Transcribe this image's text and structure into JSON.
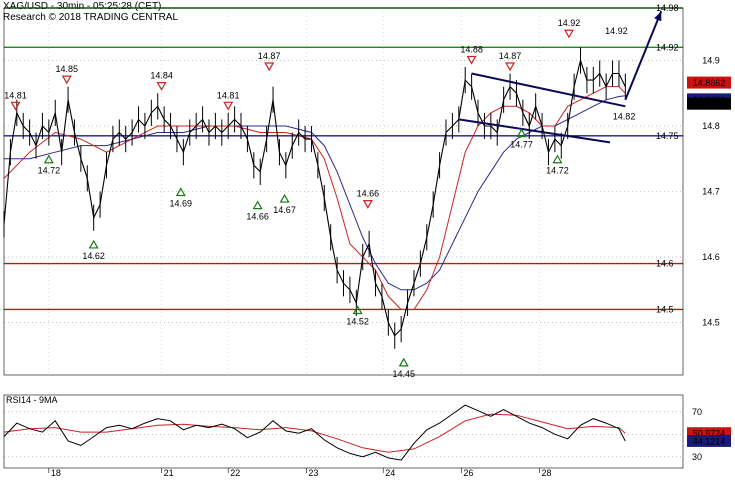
{
  "header": {
    "title": "XAG/USD - 30min - 05:25:28 (CET)",
    "research": "Research © 2018 TRADING CENTRAL"
  },
  "colors": {
    "price": "#000000",
    "ma_fast": "#cc2222",
    "ma_slow": "#2a2a8c",
    "resistance": "#1a8a1a",
    "support": "#cc1111",
    "pivot": "#1a1a99",
    "trendline": "#0a0a55",
    "marker_high": "#cc2222",
    "marker_low": "#1a7a1a"
  },
  "chart_data": [
    {
      "type": "line",
      "title": "",
      "x_ticks": [
        "18",
        "21",
        "22",
        "23",
        "24",
        "26",
        "28"
      ],
      "y_ticks": [
        14.5,
        14.6,
        14.7,
        14.8,
        14.9
      ],
      "ylim": [
        14.42,
        14.98
      ],
      "price_badges": [
        {
          "label": "14.8662",
          "value": 14.8662,
          "bg": "#cc1111",
          "fg": "#ffffff"
        },
        {
          "label": "14.8406",
          "value": 14.8406,
          "bg": "#1a1a7a",
          "fg": "#ffffff"
        },
        {
          "label": "14.834",
          "value": 14.834,
          "bg": "#000000",
          "fg": "#ffffff"
        }
      ],
      "horizontal_levels": [
        {
          "label": "14.98",
          "value": 14.98,
          "kind": "resistance"
        },
        {
          "label": "14.92",
          "value": 14.92,
          "kind": "resistance"
        },
        {
          "label": "14.75",
          "value": 14.785,
          "kind": "pivot"
        },
        {
          "label": "14.6",
          "value": 14.59,
          "kind": "support"
        },
        {
          "label": "14.5",
          "value": 14.52,
          "kind": "support"
        }
      ],
      "markers": [
        {
          "label": "14.81",
          "x": 0.9,
          "value": 14.83,
          "type": "high"
        },
        {
          "label": "14.85",
          "x": 4.9,
          "value": 14.87,
          "type": "high"
        },
        {
          "label": "14.84",
          "x": 12.3,
          "value": 14.86,
          "type": "high"
        },
        {
          "label": "14.81",
          "x": 17.5,
          "value": 14.83,
          "type": "high"
        },
        {
          "label": "14.87",
          "x": 20.7,
          "value": 14.89,
          "type": "high"
        },
        {
          "label": "14.66",
          "x": 28.4,
          "value": 14.68,
          "type": "high"
        },
        {
          "label": "14.88",
          "x": 36.5,
          "value": 14.9,
          "type": "high"
        },
        {
          "label": "14.87",
          "x": 39.5,
          "value": 14.89,
          "type": "high"
        },
        {
          "label": "14.92",
          "x": 44.1,
          "value": 14.94,
          "type": "high"
        },
        {
          "label": "14.72",
          "x": 3.5,
          "value": 14.75,
          "type": "low"
        },
        {
          "label": "14.62",
          "x": 7.0,
          "value": 14.62,
          "type": "low"
        },
        {
          "label": "14.69",
          "x": 13.8,
          "value": 14.7,
          "type": "low"
        },
        {
          "label": "14.66",
          "x": 19.8,
          "value": 14.68,
          "type": "low"
        },
        {
          "label": "14.67",
          "x": 21.9,
          "value": 14.69,
          "type": "low"
        },
        {
          "label": "14.52",
          "x": 27.6,
          "value": 14.52,
          "type": "low"
        },
        {
          "label": "14.45",
          "x": 31.2,
          "value": 14.44,
          "type": "low"
        },
        {
          "label": "14.77",
          "x": 40.4,
          "value": 14.79,
          "type": "low"
        },
        {
          "label": "14.72",
          "x": 43.2,
          "value": 14.75,
          "type": "low"
        }
      ],
      "free_labels": [
        {
          "label": "14.92",
          "x": 47.8,
          "value": 14.94
        },
        {
          "label": "14.82",
          "x": 48.4,
          "value": 14.81
        }
      ],
      "channel_lines": [
        {
          "from": [
            36.5,
            14.88
          ],
          "to": [
            48.5,
            14.83
          ]
        },
        {
          "from": [
            35.5,
            14.81
          ],
          "to": [
            47.3,
            14.775
          ]
        }
      ],
      "projection_arrow": {
        "from": [
          48.5,
          14.84
        ],
        "to": [
          51.3,
          14.975
        ]
      },
      "price_series": {
        "x": [
          0,
          0.5,
          1,
          1.5,
          2,
          2.5,
          3,
          3.5,
          4,
          4.5,
          5,
          5.5,
          6,
          6.5,
          7,
          7.5,
          8,
          8.5,
          9,
          9.5,
          10,
          10.5,
          11,
          11.5,
          12,
          12.5,
          13,
          13.5,
          14,
          14.5,
          15,
          15.5,
          16,
          16.5,
          17,
          17.5,
          18,
          18.5,
          19,
          19.5,
          20,
          20.5,
          21,
          21.5,
          22,
          22.5,
          23,
          23.5,
          24,
          24.5,
          25,
          25.5,
          26,
          26.5,
          27,
          27.5,
          28,
          28.5,
          29,
          29.5,
          30,
          30.5,
          31,
          31.5,
          32,
          32.5,
          33,
          33.5,
          34,
          34.5,
          35,
          35.5,
          36,
          36.5,
          37,
          37.5,
          38,
          38.5,
          39,
          39.5,
          40,
          40.5,
          41,
          41.5,
          42,
          42.5,
          43,
          43.5,
          44,
          44.5,
          45,
          45.5,
          46,
          46.5,
          47,
          47.5,
          48,
          48.5
        ],
        "y": [
          14.65,
          14.76,
          14.82,
          14.8,
          14.79,
          14.77,
          14.8,
          14.79,
          14.82,
          14.76,
          14.84,
          14.79,
          14.75,
          14.72,
          14.66,
          14.68,
          14.74,
          14.78,
          14.79,
          14.78,
          14.79,
          14.81,
          14.8,
          14.82,
          14.83,
          14.81,
          14.8,
          14.78,
          14.76,
          14.79,
          14.8,
          14.81,
          14.79,
          14.8,
          14.79,
          14.8,
          14.81,
          14.8,
          14.78,
          14.74,
          14.73,
          14.78,
          14.84,
          14.76,
          14.74,
          14.77,
          14.79,
          14.78,
          14.78,
          14.74,
          14.69,
          14.63,
          14.58,
          14.56,
          14.55,
          14.53,
          14.6,
          14.62,
          14.56,
          14.54,
          14.5,
          14.48,
          14.49,
          14.53,
          14.56,
          14.59,
          14.63,
          14.68,
          14.74,
          14.79,
          14.8,
          14.81,
          14.87,
          14.86,
          14.82,
          14.8,
          14.8,
          14.79,
          14.84,
          14.86,
          14.85,
          14.82,
          14.8,
          14.83,
          14.8,
          14.76,
          14.78,
          14.77,
          14.8,
          14.86,
          14.9,
          14.87,
          14.87,
          14.88,
          14.86,
          14.88,
          14.88,
          14.86,
          14.84,
          14.83
        ]
      },
      "ma_fast_series": {
        "x": [
          0,
          2,
          4,
          6,
          8,
          10,
          12,
          14,
          16,
          18,
          20,
          22,
          24,
          25,
          26,
          27,
          28,
          29,
          30,
          31,
          32,
          33,
          34,
          35,
          36,
          37,
          38,
          39,
          40,
          41,
          42,
          43,
          44,
          45,
          46,
          47,
          48,
          48.5
        ],
        "y": [
          14.72,
          14.76,
          14.79,
          14.78,
          14.76,
          14.78,
          14.8,
          14.8,
          14.8,
          14.8,
          14.79,
          14.79,
          14.78,
          14.75,
          14.69,
          14.62,
          14.6,
          14.58,
          14.54,
          14.52,
          14.52,
          14.55,
          14.6,
          14.68,
          14.76,
          14.8,
          14.82,
          14.83,
          14.83,
          14.82,
          14.8,
          14.8,
          14.83,
          14.84,
          14.85,
          14.86,
          14.86,
          14.85
        ]
      },
      "ma_slow_series": {
        "x": [
          0,
          2,
          4,
          6,
          8,
          10,
          12,
          14,
          16,
          18,
          20,
          22,
          24,
          25,
          26,
          27,
          28,
          29,
          30,
          31,
          32,
          33,
          34,
          35,
          36,
          37,
          38,
          39,
          40,
          41,
          42,
          43,
          44,
          45,
          46,
          47,
          48,
          48.5
        ],
        "y": [
          14.75,
          14.75,
          14.76,
          14.77,
          14.77,
          14.78,
          14.79,
          14.79,
          14.8,
          14.8,
          14.8,
          14.8,
          14.79,
          14.77,
          14.73,
          14.68,
          14.63,
          14.59,
          14.56,
          14.55,
          14.55,
          14.56,
          14.58,
          14.62,
          14.66,
          14.7,
          14.73,
          14.76,
          14.78,
          14.79,
          14.8,
          14.8,
          14.81,
          14.82,
          14.83,
          14.84,
          14.845,
          14.846
        ]
      }
    },
    {
      "type": "line",
      "title": "RSI14 - 9MA",
      "y_ticks": [
        30,
        50,
        70
      ],
      "ylim": [
        20,
        85
      ],
      "badges": [
        {
          "label": "50.9724",
          "value": 50.97,
          "bg": "#cc1111",
          "fg": "#ffffff"
        },
        {
          "label": "44.1214",
          "value": 44.12,
          "bg": "#1a1a7a",
          "fg": "#ffffff"
        }
      ],
      "rsi_series": {
        "x": [
          0,
          1,
          2,
          3,
          4,
          5,
          6,
          7,
          8,
          9,
          10,
          11,
          12,
          13,
          14,
          15,
          16,
          17,
          18,
          19,
          20,
          21,
          22,
          23,
          24,
          25,
          26,
          27,
          28,
          29,
          30,
          31,
          32,
          33,
          34,
          35,
          36,
          37,
          38,
          39,
          40,
          41,
          42,
          43,
          44,
          45,
          46,
          47,
          48,
          48.5
        ],
        "y": [
          48,
          60,
          55,
          52,
          62,
          44,
          40,
          48,
          56,
          58,
          55,
          60,
          64,
          62,
          54,
          58,
          56,
          59,
          55,
          47,
          52,
          62,
          53,
          51,
          55,
          45,
          38,
          33,
          30,
          34,
          29,
          27,
          42,
          54,
          60,
          68,
          76,
          71,
          66,
          72,
          66,
          60,
          56,
          50,
          46,
          58,
          64,
          60,
          55,
          44
        ]
      },
      "rsi_ma_series": {
        "x": [
          0,
          2,
          4,
          6,
          8,
          10,
          12,
          14,
          16,
          18,
          20,
          22,
          24,
          26,
          28,
          30,
          32,
          34,
          36,
          38,
          40,
          42,
          44,
          46,
          48,
          48.5
        ],
        "y": [
          52,
          55,
          56,
          52,
          52,
          55,
          58,
          59,
          57,
          56,
          54,
          56,
          53,
          46,
          38,
          34,
          37,
          48,
          62,
          68,
          67,
          61,
          55,
          57,
          56,
          51
        ]
      }
    }
  ]
}
